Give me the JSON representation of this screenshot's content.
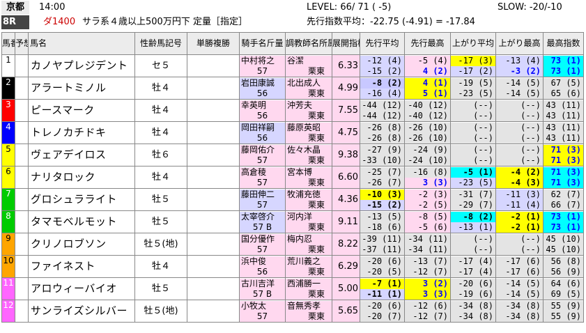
{
  "header": {
    "track": "京都",
    "race_no": "8R",
    "time": "14:00",
    "course": "ダ1400",
    "title": "サラ系４歳以上500万円下 定量［指定］",
    "level": "LEVEL: 66/ 71 ( -5)",
    "pace": "先行指数平均：-22.75 (-4.91) = -17.84",
    "slow": "SLOW: -20/-10"
  },
  "columns": {
    "umaban": [
      "馬",
      "番"
    ],
    "yoso": [
      "予",
      "想"
    ],
    "name": "馬名",
    "sex": [
      "性齢",
      "馬記号"
    ],
    "odds": [
      "単勝",
      "複勝"
    ],
    "jockey": [
      "騎手名",
      "斤量"
    ],
    "trainer": [
      "調教師名",
      "所属"
    ],
    "tenkai": [
      "展開",
      "指標"
    ],
    "senko_avg": [
      "先行",
      "平均"
    ],
    "senko_max": [
      "先行",
      "最高"
    ],
    "agari_avg": [
      "上がり",
      "平均"
    ],
    "agari_max": [
      "上がり",
      "最高"
    ],
    "best": [
      "最高",
      "指数"
    ]
  },
  "colors": {
    "header": "#ececec",
    "pink": "#ffd8ef",
    "lavender": "#d6d6ff",
    "cyan": "#00ffff",
    "yellow": "#ffff00",
    "lilac": "#c8c8ff",
    "greyback": "#e4e4e4"
  },
  "rows": [
    {
      "num": "1",
      "name": "カノヤプレジデント",
      "sex": "セ５",
      "jockey": "中村将之",
      "weight": "57",
      "trainer": "谷潔",
      "region": "栗東",
      "tenkai": "6.33",
      "sa": [
        "-12 (4)",
        "-15 (2)"
      ],
      "sm": [
        "-5 (4)",
        "4 (2)"
      ],
      "aa": [
        "-17 (3)",
        "-17 (2)"
      ],
      "am": [
        "-13 (4)",
        "-3 (2)"
      ],
      "best": [
        "73 (1)",
        "73 (1)"
      ]
    },
    {
      "num": "2",
      "name": "アラートミノル",
      "sex": "牡４",
      "jockey": "岩田康誠",
      "weight": "56",
      "trainer": "北出成人",
      "region": "栗東",
      "tenkai": "4.99",
      "sa": [
        "-8 (2)",
        "-16 (4)"
      ],
      "sm": [
        "4 (1)",
        "5 (1)"
      ],
      "aa": [
        "-19 (5)",
        "-23 (5)"
      ],
      "am": [
        "-14 (5)",
        "-14 (5)"
      ],
      "best": [
        "67 (5)",
        "65 (6)"
      ]
    },
    {
      "num": "3",
      "name": "ピースマーク",
      "sex": "牡４",
      "jockey": "幸英明",
      "weight": "56",
      "trainer": "沖芳夫",
      "region": "栗東",
      "tenkai": "7.55",
      "sa": [
        "-44 (12)",
        "-44 (12)"
      ],
      "sm": [
        "-40 (12)",
        "-40 (12)"
      ],
      "aa": [
        "(--)",
        "(--)"
      ],
      "am": [
        "(--)",
        "(--)"
      ],
      "best": [
        "43 (11)",
        "43 (11)"
      ]
    },
    {
      "num": "4",
      "name": "トレノカチドキ",
      "sex": "牡４",
      "jockey": "岡田祥嗣",
      "weight": "56",
      "trainer": "藤原英昭",
      "region": "栗東",
      "tenkai": "4.75",
      "sa": [
        "-26 (8)",
        "-26 (8)"
      ],
      "sm": [
        "-26 (10)",
        "-26 (10)"
      ],
      "aa": [
        "(--)",
        "(--)"
      ],
      "am": [
        "(--)",
        "(--)"
      ],
      "best": [
        "43 (11)",
        "43 (11)"
      ]
    },
    {
      "num": "5",
      "name": "ヴェアデイロス",
      "sex": "牡６",
      "jockey": "藤岡佑介",
      "weight": "57",
      "trainer": "佐々木晶",
      "region": "栗東",
      "tenkai": "9.38",
      "sa": [
        "-27 (9)",
        "-33 (10)"
      ],
      "sm": [
        "-24 (9)",
        "-24 (10)"
      ],
      "aa": [
        "(--)",
        "(--)"
      ],
      "am": [
        "(--)",
        "(--)"
      ],
      "best": [
        "71 (3)",
        "71 (3)"
      ]
    },
    {
      "num": "6",
      "name": "ナリタロック",
      "sex": "牡４",
      "jockey": "高倉稜",
      "weight": "57",
      "trainer": "宮本博",
      "region": "栗東",
      "tenkai": "6.60",
      "sa": [
        "-25 (7)",
        "-26 (7)"
      ],
      "sm": [
        "-16 (8)",
        "3 (3)"
      ],
      "aa": [
        "-5 (1)",
        "-23 (5)"
      ],
      "am": [
        "-4 (2)",
        "-4 (3)"
      ],
      "best": [
        "71 (3)",
        "71 (3)"
      ]
    },
    {
      "num": "7",
      "name": "グロシュラライト",
      "sex": "牡５",
      "jockey": "藤田伸二",
      "weight": "57",
      "trainer": "牧浦充徳",
      "region": "栗東",
      "tenkai": "4.36",
      "sa": [
        "-10 (3)",
        "-15 (2)"
      ],
      "sm": [
        "-2 (3)",
        "-2 (5)"
      ],
      "aa": [
        "-31 (7)",
        "-29 (7)"
      ],
      "am": [
        "-11 (3)",
        "-11 (4)"
      ],
      "best": [
        "62 (7)",
        "66 (7)"
      ]
    },
    {
      "num": "8",
      "name": "タマモベルモット",
      "sex": "牡５",
      "jockey": "太宰啓介",
      "weight": "57 B",
      "trainer": "河内洋",
      "region": "栗東",
      "tenkai": "9.11",
      "sa": [
        "-13 (5)",
        "-18 (6)"
      ],
      "sm": [
        "-8 (5)",
        "-5 (6)"
      ],
      "aa": [
        "-8 (2)",
        "-13 (1)"
      ],
      "am": [
        "-2 (1)",
        "-2 (1)"
      ],
      "best": [
        "73 (1)",
        "73 (1)"
      ]
    },
    {
      "num": "9",
      "name": "クリノロブソン",
      "sex": "牡５(地)",
      "jockey": "国分優作",
      "weight": "57",
      "trainer": "梅内忍",
      "region": "栗東",
      "tenkai": "8.22",
      "sa": [
        "-39 (11)",
        "-37 (11)"
      ],
      "sm": [
        "-34 (11)",
        "-34 (11)"
      ],
      "aa": [
        "(--)",
        "(--)"
      ],
      "am": [
        "(--)",
        "(--)"
      ],
      "best": [
        "45 (10)",
        "45 (10)"
      ]
    },
    {
      "num": "10",
      "name": "ファイネスト",
      "sex": "牡４",
      "jockey": "浜中俊",
      "weight": "56",
      "trainer": "荒川義之",
      "region": "栗東",
      "tenkai": "6.29",
      "sa": [
        "-20 (6)",
        "-20 (5)"
      ],
      "sm": [
        "-13 (7)",
        "-12 (7)"
      ],
      "aa": [
        "-17 (4)",
        "-17 (4)"
      ],
      "am": [
        "-17 (6)",
        "-17 (6)"
      ],
      "best": [
        "56 (8)",
        "56 (9)"
      ]
    },
    {
      "num": "11",
      "name": "アロウィーバイオ",
      "sex": "牡５",
      "jockey": "古川吉洋",
      "weight": "57 B",
      "trainer": "西浦勝一",
      "region": "栗東",
      "tenkai": "5.00",
      "sa": [
        "-7 (1)",
        "-11 (1)"
      ],
      "sm": [
        "3 (2)",
        "3 (3)"
      ],
      "aa": [
        "-20 (6)",
        "-19 (6)"
      ],
      "am": [
        "-14 (5)",
        "-14 (5)"
      ],
      "best": [
        "64 (6)",
        "69 (5)"
      ]
    },
    {
      "num": "12",
      "name": "サンライズシルバー",
      "sex": "牡５(地)",
      "jockey": "小牧太",
      "weight": "57",
      "trainer": "音無秀孝",
      "region": "栗東",
      "tenkai": "5.65",
      "sa": [
        "-20 (6)",
        "-20 (7)"
      ],
      "sm": [
        "-12 (6)",
        "-12 (7)"
      ],
      "aa": [
        "-34 (8)",
        "-34 (8)"
      ],
      "am": [
        "-34 (8)",
        "-34 (8)"
      ],
      "best": [
        "55 (9)",
        "55 (9)"
      ]
    }
  ]
}
